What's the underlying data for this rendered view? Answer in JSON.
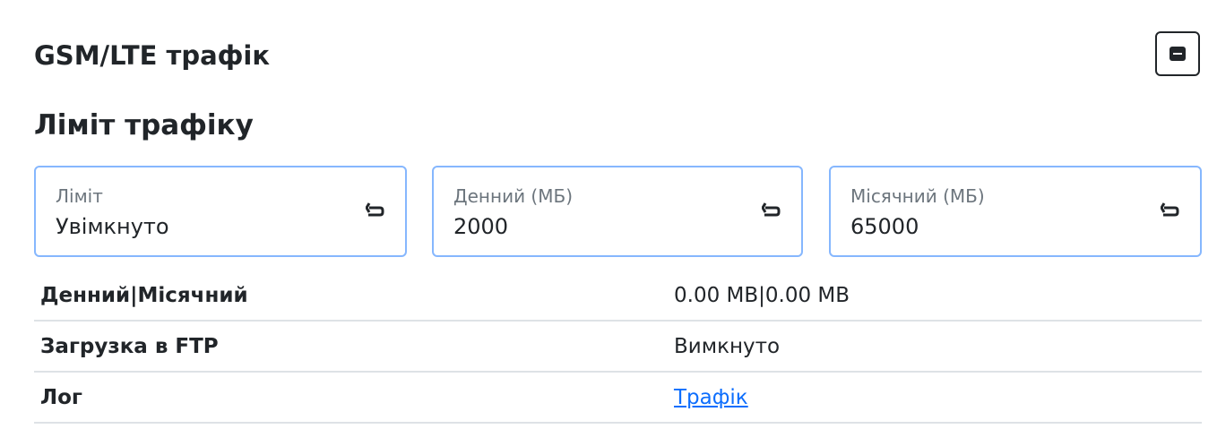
{
  "card": {
    "title": "GSM/LTE трафік",
    "collapse_icon": "minus-square-icon"
  },
  "section": {
    "title": "Ліміт трафіку"
  },
  "fields": [
    {
      "label": "Ліміт",
      "value": "Увімкнуто",
      "icon": "reset-arrow-icon"
    },
    {
      "label": "Денний (МБ)",
      "value": "2000",
      "icon": "reset-arrow-icon"
    },
    {
      "label": "Місячний (МБ)",
      "value": "65000",
      "icon": "reset-arrow-icon"
    }
  ],
  "rows": [
    {
      "key": "Денний|Місячний",
      "value": "0.00 MB|0.00 MB"
    },
    {
      "key": "Загрузка в FTP",
      "value": "Вимкнуто"
    },
    {
      "key": "Лог",
      "value": "Трафік"
    }
  ],
  "colors": {
    "field_border": "#86b7fe",
    "link": "#0d6efd",
    "divider": "#dee2e6"
  }
}
